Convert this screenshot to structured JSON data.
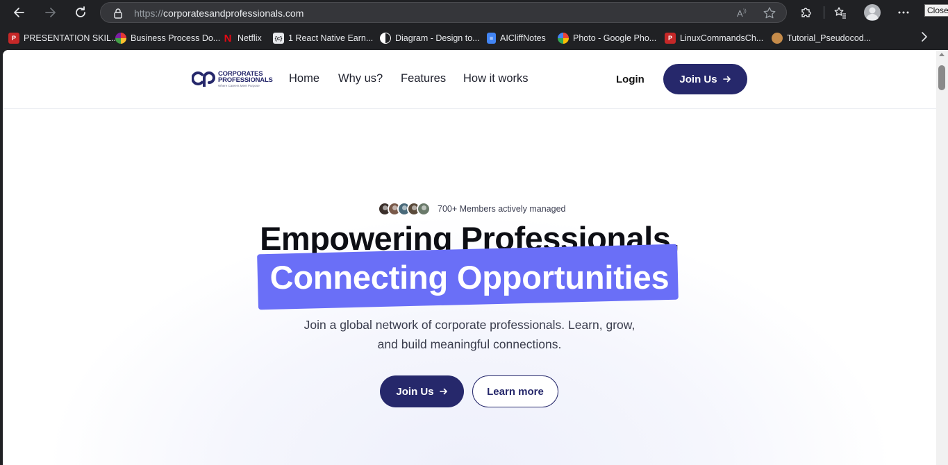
{
  "browser": {
    "url_scheme": "https://",
    "url_host": "corporatesandprofessionals.com",
    "tooltip": "Close",
    "bookmarks": [
      {
        "label": "PRESENTATION SKIL...",
        "icon": "pdf-icon",
        "color": "#c62828"
      },
      {
        "label": "Business Process Do...",
        "icon": "pinwheel-icon",
        "color": "#7b1fa2"
      },
      {
        "label": "Netflix",
        "icon": "netflix-icon",
        "color": "#e50914"
      },
      {
        "label": "1 React Native Earn...",
        "icon": "code-bracket-icon",
        "color": "#e8eaed"
      },
      {
        "label": "Diagram - Design to...",
        "icon": "half-circle-icon",
        "color": "#ffffff"
      },
      {
        "label": "AICliffNotes",
        "icon": "google-docs-icon",
        "color": "#4285f4"
      },
      {
        "label": "Photo - Google Pho...",
        "icon": "google-photos-icon",
        "color": "#fbbc04"
      },
      {
        "label": "LinuxCommandsCh...",
        "icon": "pdf-icon",
        "color": "#c62828"
      },
      {
        "label": "Tutorial_Pseudocod...",
        "icon": "scroll-icon",
        "color": "#c58b4a"
      }
    ]
  },
  "site": {
    "logo_line1": "CORPORATES",
    "logo_line2": "PROFESSIONALS",
    "logo_tagline": "Where Careers Meet Purpose",
    "nav": [
      {
        "label": "Home"
      },
      {
        "label": "Why us?"
      },
      {
        "label": "Features"
      },
      {
        "label": "How it works"
      }
    ],
    "login_label": "Login",
    "join_label": "Join Us",
    "hero": {
      "members_text": "700+ Members actively managed",
      "avatar_colors": [
        "#3a2f2a",
        "#7a5a4a",
        "#4a6a7a",
        "#5a4a3a",
        "#6a7a6a"
      ],
      "title_line1": "Empowering Professionals,",
      "title_line2": "Connecting Opportunities",
      "subtitle": "Join a global network of corporate professionals. Learn, grow, and build meaningful connections.",
      "join_label": "Join Us",
      "learn_label": "Learn more"
    },
    "colors": {
      "brand_navy": "#26286b",
      "highlight": "#6a6ff7"
    }
  }
}
